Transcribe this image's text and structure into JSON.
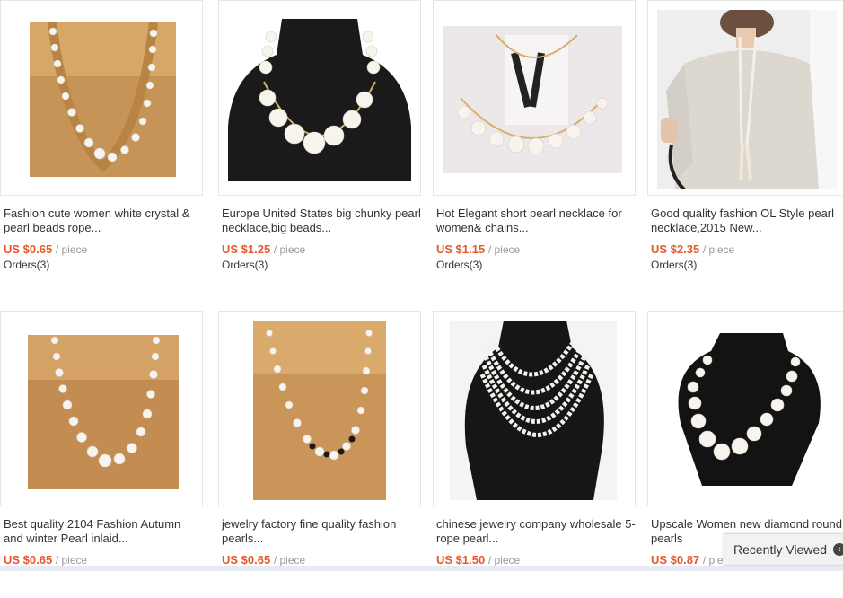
{
  "products": [
    {
      "title": "Fashion cute women white crystal & pearl beads rope...",
      "currency": "US $0.65",
      "unit": "/ piece",
      "orders": "Orders(3)"
    },
    {
      "title": "Europe United States big chunky pearl necklace,big beads...",
      "currency": "US $1.25",
      "unit": "/ piece",
      "orders": "Orders(3)"
    },
    {
      "title": "Hot Elegant short pearl necklace for women& chains...",
      "currency": "US $1.15",
      "unit": "/ piece",
      "orders": "Orders(3)"
    },
    {
      "title": "Good quality fashion OL Style pearl necklace,2015 New...",
      "currency": "US $2.35",
      "unit": "/ piece",
      "orders": "Orders(3)"
    },
    {
      "title": "Best quality 2104 Fashion Autumn and winter Pearl inlaid...",
      "currency": "US $0.65",
      "unit": "/ piece",
      "orders": ""
    },
    {
      "title": "jewelry factory fine quality fashion pearls...",
      "currency": "US $0.65",
      "unit": "/ piece",
      "orders": ""
    },
    {
      "title": "chinese jewelry company wholesale 5-rope pearl...",
      "currency": "US $1.50",
      "unit": "/ piece",
      "orders": ""
    },
    {
      "title": "Upscale Women new diamond round pearls",
      "currency": "US $0.87",
      "unit": "/ pie",
      "orders": ""
    }
  ],
  "recently_viewed": {
    "label": "Recently Viewed",
    "icon": "chevron-left-icon"
  },
  "colors": {
    "price": "#e8582a",
    "title": "#333333",
    "unit": "#999999",
    "border": "#e6e6e6"
  }
}
